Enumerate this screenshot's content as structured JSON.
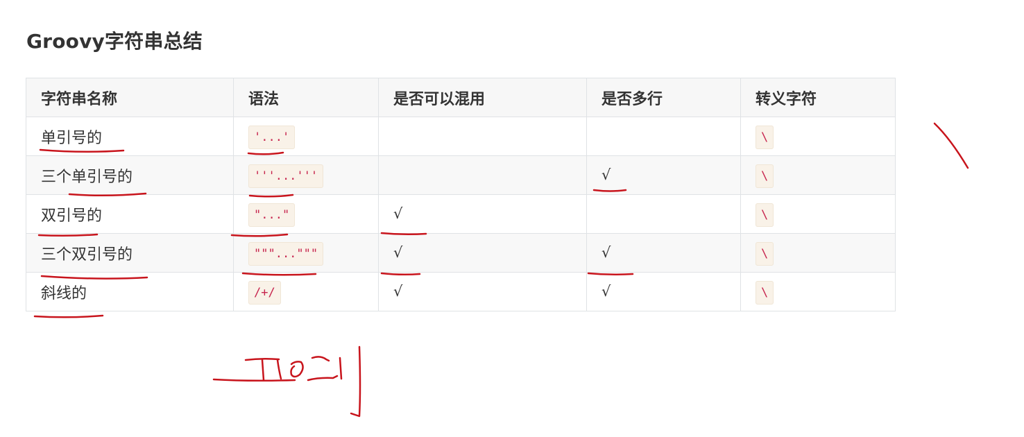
{
  "page": {
    "title": "Groovy字符串总结"
  },
  "table": {
    "headers": [
      "字符串名称",
      "语法",
      "是否可以混用",
      "是否多行",
      "转义字符"
    ],
    "rows": [
      {
        "name": "单引号的",
        "syntax": "'...'",
        "mixable": "",
        "multiline": "",
        "escape": "\\"
      },
      {
        "name": "三个单引号的",
        "syntax": "'''...'''",
        "mixable": "",
        "multiline": "√",
        "escape": "\\"
      },
      {
        "name": "双引号的",
        "syntax": "\"...\"",
        "mixable": "√",
        "multiline": "",
        "escape": "\\"
      },
      {
        "name": "三个双引号的",
        "syntax": "\"\"\"...\"\"\"",
        "mixable": "√",
        "multiline": "√",
        "escape": "\\"
      },
      {
        "name": "斜线的",
        "syntax": "/+/",
        "mixable": "√",
        "multiline": "√",
        "escape": "\\"
      }
    ]
  },
  "annotations": {
    "ink_color": "#c8141c"
  },
  "colors": {
    "code_text": "#c7254e",
    "code_background": "#f9f2e8",
    "header_background": "#f7f7f7",
    "border": "#dfe2e5"
  }
}
